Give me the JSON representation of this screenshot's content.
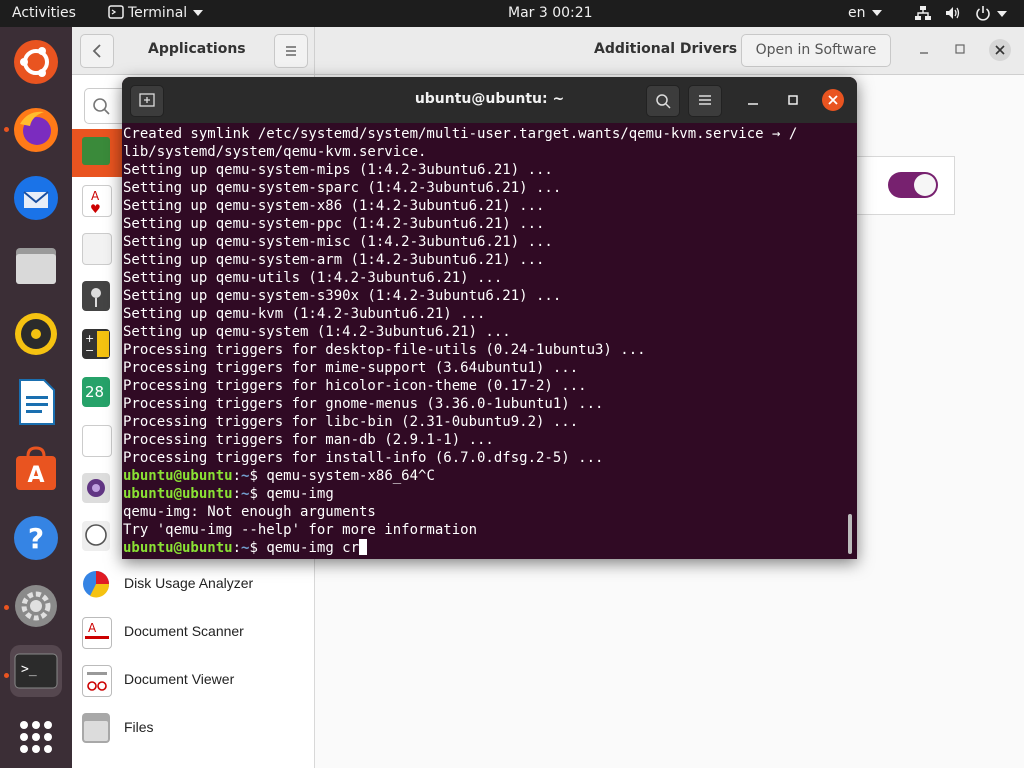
{
  "topbar": {
    "activities": "Activities",
    "app_menu": "Terminal",
    "clock": "Mar 3  00:21",
    "lang": "en"
  },
  "software": {
    "left_title": "Applications",
    "window_title": "Additional Drivers",
    "open_button": "Open in Software",
    "apps": [
      {
        "name": "Disk Usage Analyzer"
      },
      {
        "name": "Document Scanner"
      },
      {
        "name": "Document Viewer"
      },
      {
        "name": "Files"
      }
    ],
    "calendar_day": "28",
    "toggle_on": true
  },
  "terminal": {
    "title": "ubuntu@ubuntu: ~",
    "prompt_user": "ubuntu@ubuntu",
    "prompt_sep": ":",
    "prompt_path": "~",
    "prompt_sign": "$ ",
    "output_lines": [
      "Created symlink /etc/systemd/system/multi-user.target.wants/qemu-kvm.service → /",
      "lib/systemd/system/qemu-kvm.service.",
      "Setting up qemu-system-mips (1:4.2-3ubuntu6.21) ...",
      "Setting up qemu-system-sparc (1:4.2-3ubuntu6.21) ...",
      "Setting up qemu-system-x86 (1:4.2-3ubuntu6.21) ...",
      "Setting up qemu-system-ppc (1:4.2-3ubuntu6.21) ...",
      "Setting up qemu-system-misc (1:4.2-3ubuntu6.21) ...",
      "Setting up qemu-system-arm (1:4.2-3ubuntu6.21) ...",
      "Setting up qemu-utils (1:4.2-3ubuntu6.21) ...",
      "Setting up qemu-system-s390x (1:4.2-3ubuntu6.21) ...",
      "Setting up qemu-kvm (1:4.2-3ubuntu6.21) ...",
      "Setting up qemu-system (1:4.2-3ubuntu6.21) ...",
      "Processing triggers for desktop-file-utils (0.24-1ubuntu3) ...",
      "Processing triggers for mime-support (3.64ubuntu1) ...",
      "Processing triggers for hicolor-icon-theme (0.17-2) ...",
      "Processing triggers for gnome-menus (3.36.0-1ubuntu1) ...",
      "Processing triggers for libc-bin (2.31-0ubuntu9.2) ...",
      "Processing triggers for man-db (2.9.1-1) ...",
      "Processing triggers for install-info (6.7.0.dfsg.2-5) ..."
    ],
    "cmd1": "qemu-system-x86_64^C",
    "cmd2": "qemu-img",
    "out_a": "qemu-img: Not enough arguments",
    "out_b": "Try 'qemu-img --help' for more information",
    "cmd3": "qemu-img cr"
  },
  "colors": {
    "terminal_bg": "#300a24",
    "prompt_user": "#8ae234",
    "prompt_path": "#729fcf",
    "accent": "#e95420"
  }
}
